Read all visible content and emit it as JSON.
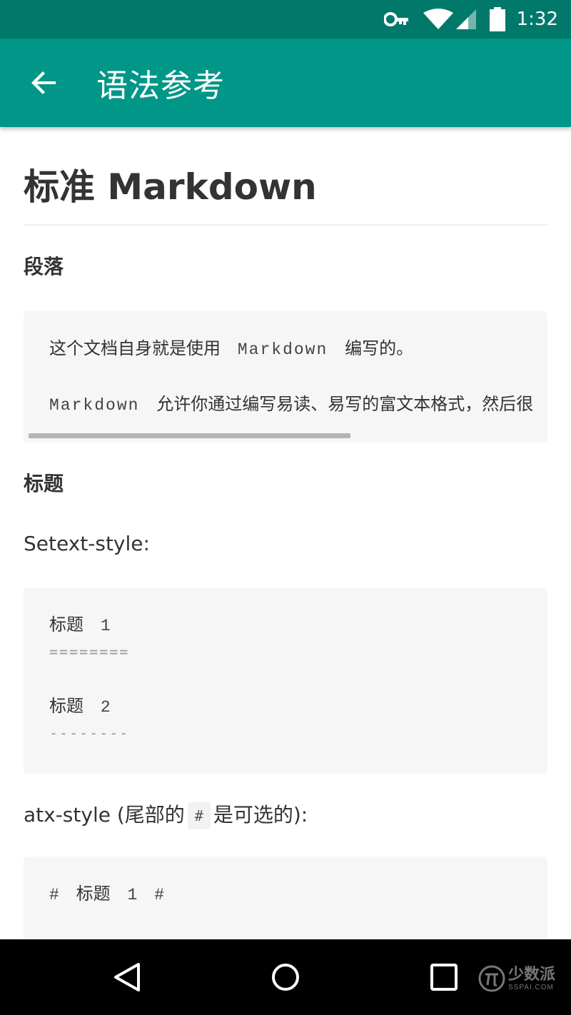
{
  "status_bar": {
    "time": "1:32",
    "icons": [
      "key-icon",
      "wifi-icon",
      "signal-icon",
      "battery-icon"
    ]
  },
  "app_bar": {
    "title": "语法参考",
    "back_icon": "arrow-back-icon",
    "background": "#009688",
    "status_background": "#00796b"
  },
  "content": {
    "h1": "标准 Markdown",
    "paragraph_section": {
      "heading": "段落",
      "code": {
        "line1_cn": "这个文档自身就是使用",
        "line1_code": "Markdown",
        "line1_tail": "编写的。",
        "line2_code": "Markdown",
        "line2_cn": "允许你通过编写易读、易写的富文本格式，然后很"
      }
    },
    "heading_section": {
      "heading": "标题",
      "setext_label": "Setext-style:",
      "setext_code": {
        "h1_text": "标题",
        "h1_num": "1",
        "h1_underline": "========",
        "h2_text": "标题",
        "h2_num": "2",
        "h2_underline": "--------"
      },
      "atx_label_prefix": "atx-style (尾部的",
      "atx_inline_code": "#",
      "atx_label_suffix": "是可选的):",
      "atx_code": {
        "hash_open": "#",
        "text": "标题",
        "num": "1",
        "hash_close": "#"
      }
    }
  },
  "nav_bar": {
    "icons": [
      "back-triangle-icon",
      "home-circle-icon",
      "recents-square-icon"
    ],
    "watermark_main": "少数派",
    "watermark_sub": "SSPAI.COM"
  }
}
